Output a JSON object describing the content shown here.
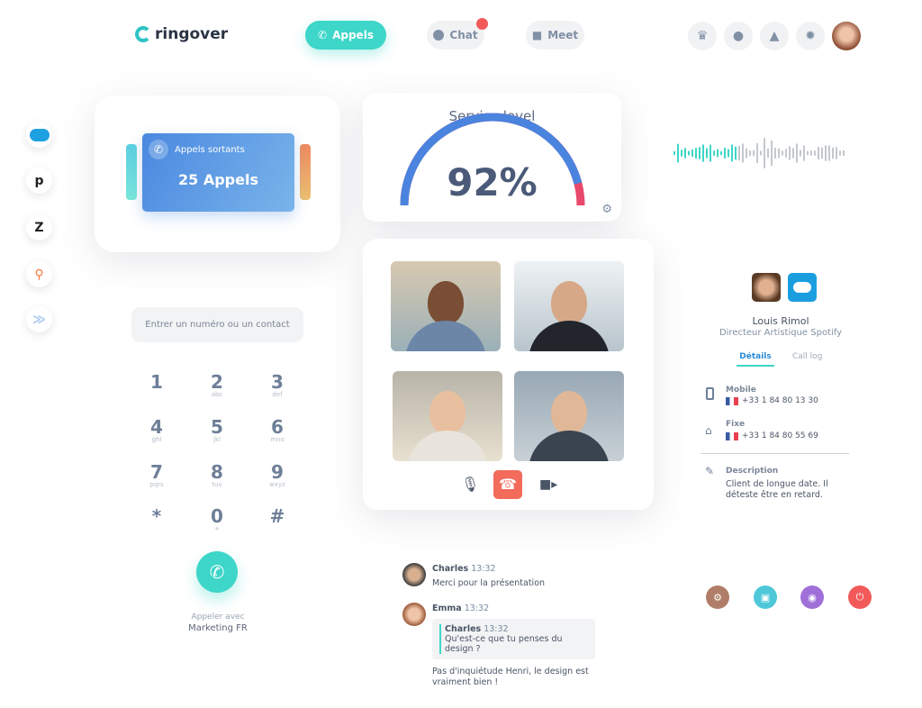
{
  "header": {
    "logo": "ringover",
    "nav": [
      {
        "label": "Appels",
        "icon": "phone-icon",
        "active": true
      },
      {
        "label": "Chat",
        "icon": "chat-icon",
        "badge": true
      },
      {
        "label": "Meet",
        "icon": "video-icon"
      }
    ],
    "icons": [
      "crown-icon",
      "user-icon",
      "bell-icon",
      "gear-icon"
    ]
  },
  "integrations": [
    "salesforce",
    "pipedrive",
    "zendesk",
    "hubspot",
    "more"
  ],
  "stats": {
    "label": "Appels sortants",
    "value": "25 Appels"
  },
  "service": {
    "title": "Service level",
    "value": "92%",
    "percent": 92
  },
  "dialer": {
    "placeholder": "Entrer un numéro ou un contact",
    "keys": [
      [
        "1",
        ""
      ],
      [
        "2",
        "abc"
      ],
      [
        "3",
        "def"
      ],
      [
        "4",
        "ghi"
      ],
      [
        "5",
        "jkl"
      ],
      [
        "6",
        "mno"
      ],
      [
        "7",
        "pqrs"
      ],
      [
        "8",
        "tuv"
      ],
      [
        "9",
        "wxyz"
      ],
      [
        "*",
        ""
      ],
      [
        "0",
        "+"
      ],
      [
        "#",
        ""
      ]
    ],
    "call_with": "Appeler avec",
    "line": "Marketing FR"
  },
  "contact": {
    "name": "Louis Rimol",
    "title": "Directeur Artistique Spotify",
    "tabs": [
      "Détails",
      "Call log"
    ],
    "mobile_label": "Mobile",
    "mobile": "+33 1 84 80 13 30",
    "fixe_label": "Fixe",
    "fixe": "+33 1 84 80 55 69",
    "desc_label": "Description",
    "desc": "Client de longue date. Il déteste être en retard."
  },
  "chat": [
    {
      "author": "Charles",
      "time": "13:32",
      "text": "Merci pour la présentation"
    },
    {
      "author": "Emma",
      "time": "13:32",
      "quote_author": "Charles",
      "quote_time": "13:32",
      "quote": "Qu'est-ce que tu penses du design ?",
      "text": "Pas d'inquiétude Henri, le design est vraiment bien !"
    }
  ],
  "colors": {
    "teal": "#3dd6c8",
    "blue": "#4f8fe3",
    "red": "#f26b5b",
    "gauge_end": "#e8486a"
  }
}
